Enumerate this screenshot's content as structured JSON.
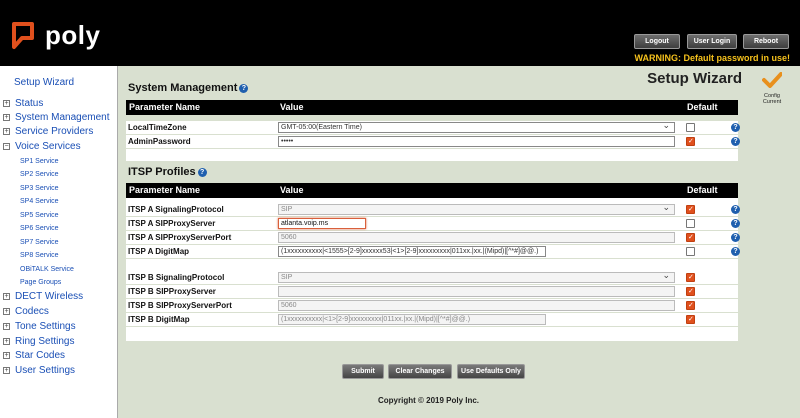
{
  "header": {
    "brand": "poly",
    "buttons": {
      "logout": "Logout",
      "user_login": "User Login",
      "reboot": "Reboot"
    },
    "warning": "WARNING: Default password in use!"
  },
  "sidebar": {
    "wizard": "Setup Wizard",
    "items": [
      {
        "label": "Status",
        "expander": "+"
      },
      {
        "label": "System Management",
        "expander": "+"
      },
      {
        "label": "Service Providers",
        "expander": "+"
      },
      {
        "label": "Voice Services",
        "expander": "−"
      }
    ],
    "sub_items": [
      "SP1 Service",
      "SP2 Service",
      "SP3 Service",
      "SP4 Service",
      "SP5 Service",
      "SP6 Service",
      "SP7 Service",
      "SP8 Service",
      "OBiTALK Service",
      "Page Groups"
    ],
    "items_after": [
      {
        "label": "DECT Wireless",
        "expander": "+"
      },
      {
        "label": "Codecs",
        "expander": "+"
      },
      {
        "label": "Tone Settings",
        "expander": "+"
      },
      {
        "label": "Ring Settings",
        "expander": "+"
      },
      {
        "label": "Star Codes",
        "expander": "+"
      },
      {
        "label": "User Settings",
        "expander": "+"
      }
    ]
  },
  "main": {
    "title": "Setup Wizard",
    "config_label_1": "Config",
    "config_label_2": "Current",
    "help_glyph": "?",
    "columns": {
      "name": "Parameter Name",
      "value": "Value",
      "default": "Default"
    },
    "system_section": {
      "title": "System Management",
      "rows": [
        {
          "name": "LocalTimeZone",
          "value": "GMT-05:00(Eastern Time)",
          "default": false
        },
        {
          "name": "AdminPassword",
          "value": "•••••",
          "default": true
        }
      ]
    },
    "itsp_section": {
      "title": "ITSP Profiles",
      "rows": [
        {
          "name": "ITSP A SignalingProtocol",
          "value": "SIP",
          "default": true
        },
        {
          "name": "ITSP A SIPProxyServer",
          "value": "atlanta.voip.ms",
          "default": false
        },
        {
          "name": "ITSP A SIPProxyServerPort",
          "value": "5060",
          "default": true
        },
        {
          "name": "ITSP A DigitMap",
          "value": "(1xxxxxxxxxx|<1555>[2-9]xxxxxx53|<1>[2-9]xxxxxxxxx|011xx.|xx.|(Mipd)|[^*#]@@.)",
          "default": false
        },
        {
          "name": "ITSP B SignalingProtocol",
          "value": "SIP",
          "default": true
        },
        {
          "name": "ITSP B SIPProxyServer",
          "value": "",
          "default": true
        },
        {
          "name": "ITSP B SIPProxyServerPort",
          "value": "5060",
          "default": true
        },
        {
          "name": "ITSP B DigitMap",
          "value": "(1xxxxxxxxxx|<1>[2-9]xxxxxxxxx|011xx.|xx.|(Mipd)|[^*#]@@.)",
          "default": true
        }
      ]
    }
  },
  "footer": {
    "submit": "Submit",
    "clear": "Clear Changes",
    "defaults": "Use Defaults Only",
    "copyright": "Copyright © 2019 Poly Inc."
  },
  "colors": {
    "accent": "#e0501d",
    "link": "#1a4fb5",
    "warning": "#f6c21c"
  }
}
